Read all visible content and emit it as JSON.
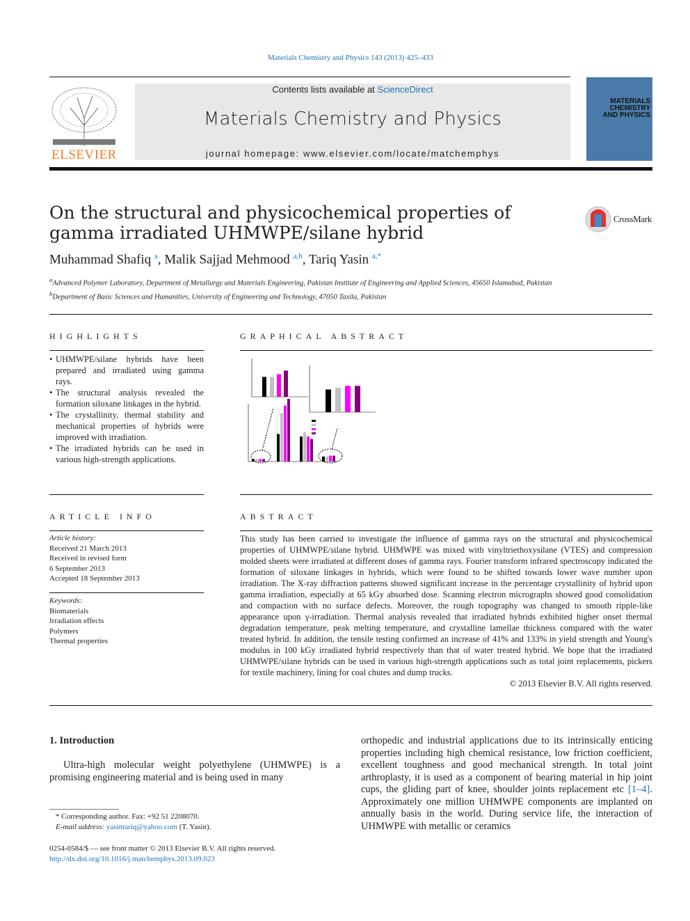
{
  "header": {
    "journal_ref": "Materials Chemistry and Physics 143 (2013) 425–433",
    "contents_prefix": "Contents lists available at ",
    "contents_link": "ScienceDirect",
    "journal_title": "Materials Chemistry and Physics",
    "homepage": "journal homepage: www.elsevier.com/locate/matchemphys",
    "publisher": "ELSEVIER",
    "cover_title": "MATERIALS CHEMISTRY AND PHYSICS"
  },
  "article": {
    "title": "On the structural and physicochemical properties of gamma irradiated UHMWPE/silane hybrid",
    "crossmark": "CrossMark",
    "authors": [
      {
        "name": "Muhammad Shafiq",
        "sup": "a"
      },
      {
        "name": "Malik Sajjad Mehmood",
        "sup": "a,b"
      },
      {
        "name": "Tariq Yasin",
        "sup": "a,*"
      }
    ],
    "affiliations": [
      {
        "sup": "a",
        "text": "Advanced Polymer Laboratory, Department of Metallurgy and Materials Engineering, Pakistan Institute of Engineering and Applied Sciences, 45650 Islamabad, Pakistan"
      },
      {
        "sup": "b",
        "text": "Department of Basic Sciences and Humanities, University of Engineering and Technology, 47050 Taxila, Pakistan"
      }
    ]
  },
  "highlights": {
    "heading": "HIGHLIGHTS",
    "items": [
      "UHMWPE/silane hybrids have been prepared and irradiated using gamma rays.",
      "The structural analysis revealed the formation siloxane linkages in the hybrid.",
      "The crystallinity, thermal stability and mechanical properties of hybrids were improved with irradiation.",
      "The irradiated hybrids can be used in various high-strength applications."
    ]
  },
  "graphical_abstract": {
    "heading": "GRAPHICAL ABSTRACT",
    "colors": [
      "#000000",
      "#c0c0c0",
      "#ff00ff",
      "#800080"
    ]
  },
  "article_info": {
    "heading": "ARTICLE INFO",
    "history_label": "Article history:",
    "history": [
      "Received 21 March 2013",
      "Received in revised form",
      "6 September 2013",
      "Accepted 18 September 2013"
    ],
    "keywords_label": "Keywords:",
    "keywords": [
      "Biomaterials",
      "Irradiation effects",
      "Polymers",
      "Thermal properties"
    ]
  },
  "abstract": {
    "heading": "ABSTRACT",
    "text": "This study has been carried to investigate the influence of gamma rays on the structural and physicochemical properties of UHMWPE/silane hybrid. UHMWPE was mixed with vinyltriethoxysilane (VTES) and compression molded sheets were irradiated at different doses of gamma rays. Fourier transform infrared spectroscopy indicated the formation of siloxane linkages in hybrids, which were found to be shifted towards lower wave number upon irradiation. The X-ray diffraction patterns showed significant increase in the percentage crystallinity of hybrid upon gamma irradiation, especially at 65 kGy absorbed dose. Scanning electron micrographs showed good consolidation and compaction with no surface defects. Moreover, the rough topography was changed to smooth ripple-like appearance upon γ-irradiation. Thermal analysis revealed that irradiated hybrids exhibited higher onset thermal degradation temperature, peak melting temperature, and crystalline lamellae thickness compared with the water treated hybrid. In addition, the tensile testing confirmed an increase of 41% and 133% in yield strength and Young's modulus in 100 kGy irradiated hybrid respectively than that of water treated hybrid. We hope that the irradiated UHMWPE/silane hybrids can be used in various high-strength applications such as total joint replacements, pickers for textile machinery, lining for coal chutes and dump trucks.",
    "copyright": "© 2013 Elsevier B.V. All rights reserved."
  },
  "intro": {
    "heading": "1. Introduction",
    "p1": "Ultra-high molecular weight polyethylene (UHMWPE) is a promising engineering material and is being used in many",
    "p2a": "orthopedic and industrial applications due to its intrinsically enticing properties including high chemical resistance, low friction coefficient, excellent toughness and good mechanical strength. In total joint arthroplasty, it is used as a component of bearing material in hip joint cups, the gliding part of knee, shoulder joints replacement etc ",
    "p2ref": "[1–4]",
    "p2b": ". Approximately one million UHMWPE components are implanted on annually basis in the world. During service life, the interaction of UHMWPE with metallic or ceramics"
  },
  "footnote": {
    "corr": "* Corresponding author. Fax: +92 51 2208070.",
    "email_label": "E-mail address: ",
    "email": "yasintariq@yahoo.com",
    "email_suffix": " (T. Yasin)."
  },
  "footer": {
    "issn": "0254-0584/$ — see front matter © 2013 Elsevier B.V. All rights reserved.",
    "doi": "http://dx.doi.org/10.1016/j.matchemphys.2013.09.023"
  }
}
